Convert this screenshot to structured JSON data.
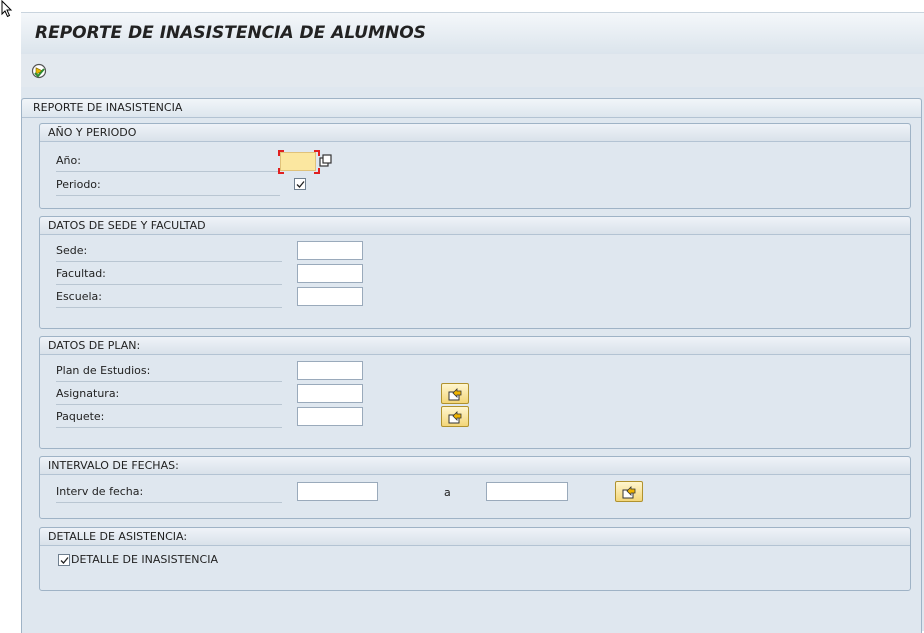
{
  "title": "REPORTE DE INASISTENCIA DE ALUMNOS",
  "outer_title": "REPORTE DE INASISTENCIA",
  "icons": {
    "cursor": "mouse-pointer-icon",
    "execute": "execute-icon",
    "multiple_selection": "multiple-selection-icon",
    "select_arrow": "multiple-selection-arrow-icon",
    "checkbox": "checkmark-icon"
  },
  "groups": {
    "anio_periodo": {
      "title": "AÑO Y PERIODO",
      "anio_label": "Año:",
      "anio_value": "",
      "periodo_label": "Periodo:",
      "periodo_checked": true
    },
    "sede_facultad": {
      "title": "DATOS DE SEDE Y FACULTAD",
      "sede_label": "Sede:",
      "sede_value": "",
      "facultad_label": "Facultad:",
      "facultad_value": "",
      "escuela_label": "Escuela:",
      "escuela_value": ""
    },
    "plan": {
      "title": "DATOS DE PLAN:",
      "plan_label": "Plan de Estudios:",
      "plan_value": "",
      "asignatura_label": "Asignatura:",
      "asignatura_value": "",
      "paquete_label": "Paquete:",
      "paquete_value": ""
    },
    "fechas": {
      "title": "INTERVALO DE FECHAS:",
      "interv_label": "Interv de fecha:",
      "from_value": "",
      "to_label": "a",
      "to_value": ""
    },
    "detalle": {
      "title": "DETALLE DE ASISTENCIA:",
      "checkbox_label": "DETALLE DE INASISTENCIA",
      "checked": true
    }
  },
  "colors": {
    "background": "#dfe7ef",
    "required_field": "#fbe7a0",
    "selection_button": "#f3d679",
    "required_marker": "#e02020"
  }
}
